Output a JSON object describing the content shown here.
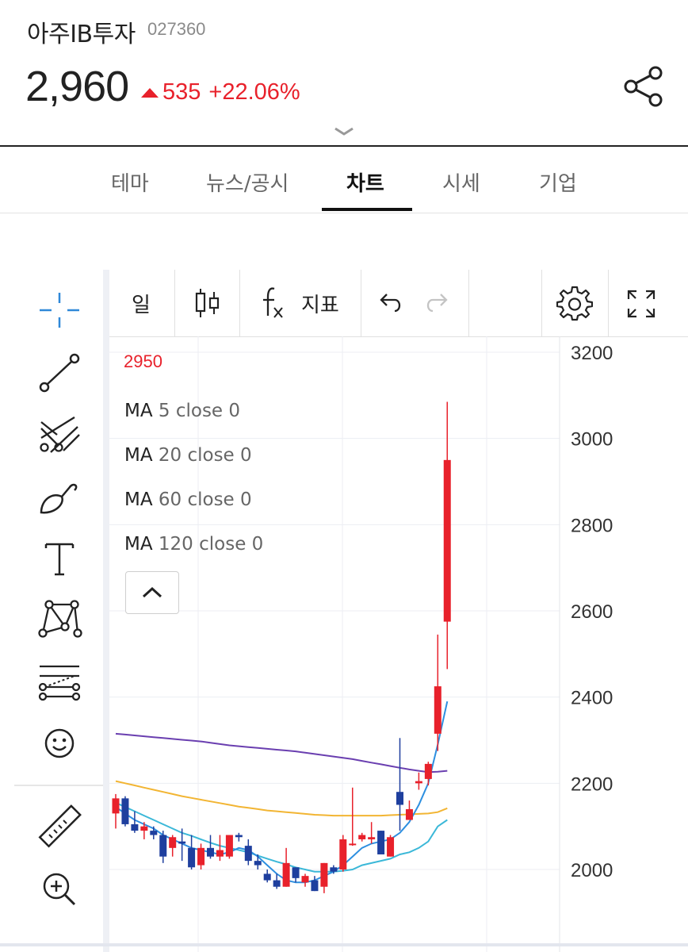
{
  "stock": {
    "name": "아주IB투자",
    "code": "027360",
    "price": "2,960",
    "change": "535",
    "change_pct": "+22.06%",
    "up_color": "#e8212b",
    "down_color": "#1e3f9e"
  },
  "icons": {
    "share": "share-icon",
    "expand": "chevron-down-icon"
  },
  "tabs": [
    {
      "label": "테마",
      "active": false
    },
    {
      "label": "뉴스/공시",
      "active": false
    },
    {
      "label": "차트",
      "active": true
    },
    {
      "label": "시세",
      "active": false
    },
    {
      "label": "기업",
      "active": false
    }
  ],
  "toolbar": {
    "period": "일",
    "candle_icon": "candlestick-icon",
    "indicator_icon": "function-icon",
    "indicator_label": "지표",
    "undo_icon": "undo-icon",
    "redo_icon": "redo-icon",
    "settings_icon": "gear-icon",
    "fullscreen_icon": "fullscreen-icon"
  },
  "drawing_tools": [
    "crosshair-icon",
    "trend-line-icon",
    "pitchfork-icon",
    "brush-icon",
    "text-icon",
    "pattern-icon",
    "fibonacci-icon",
    "emoji-icon",
    "ruler-icon",
    "zoom-in-icon"
  ],
  "legend": {
    "price": "2950",
    "ma": [
      {
        "name": "MA",
        "args": "5 close 0"
      },
      {
        "name": "MA",
        "args": "20 close 0"
      },
      {
        "name": "MA",
        "args": "60 close 0"
      },
      {
        "name": "MA",
        "args": "120 close 0"
      }
    ]
  },
  "chart_data": {
    "type": "candlestick",
    "y_ticks": [
      "3200",
      "3000",
      "2800",
      "2600",
      "2400",
      "2200",
      "2000"
    ],
    "ylim": [
      1820,
      3210
    ],
    "grid": true,
    "candles": [
      {
        "o": 2130,
        "h": 2175,
        "l": 2095,
        "c": 2165
      },
      {
        "o": 2165,
        "h": 2170,
        "l": 2100,
        "c": 2105
      },
      {
        "o": 2105,
        "h": 2135,
        "l": 2085,
        "c": 2090
      },
      {
        "o": 2090,
        "h": 2110,
        "l": 2070,
        "c": 2100
      },
      {
        "o": 2090,
        "h": 2100,
        "l": 2070,
        "c": 2080
      },
      {
        "o": 2080,
        "h": 2090,
        "l": 2015,
        "c": 2030
      },
      {
        "o": 2050,
        "h": 2080,
        "l": 2030,
        "c": 2075
      },
      {
        "o": 2065,
        "h": 2095,
        "l": 2020,
        "c": 2060
      },
      {
        "o": 2050,
        "h": 2080,
        "l": 2000,
        "c": 2005
      },
      {
        "o": 2010,
        "h": 2060,
        "l": 2000,
        "c": 2050
      },
      {
        "o": 2050,
        "h": 2080,
        "l": 2025,
        "c": 2030
      },
      {
        "o": 2030,
        "h": 2080,
        "l": 2020,
        "c": 2045
      },
      {
        "o": 2030,
        "h": 2060,
        "l": 2025,
        "c": 2080
      },
      {
        "o": 2080,
        "h": 2085,
        "l": 2065,
        "c": 2075
      },
      {
        "o": 2055,
        "h": 2070,
        "l": 2010,
        "c": 2020
      },
      {
        "o": 2020,
        "h": 2035,
        "l": 2000,
        "c": 2010
      },
      {
        "o": 1990,
        "h": 2000,
        "l": 1970,
        "c": 1975
      },
      {
        "o": 1975,
        "h": 1990,
        "l": 1955,
        "c": 1960
      },
      {
        "o": 1960,
        "h": 2050,
        "l": 1960,
        "c": 2015
      },
      {
        "o": 2005,
        "h": 2005,
        "l": 1970,
        "c": 1980
      },
      {
        "o": 1970,
        "h": 1990,
        "l": 1960,
        "c": 1985
      },
      {
        "o": 1975,
        "h": 1985,
        "l": 1950,
        "c": 1950
      },
      {
        "o": 1960,
        "h": 2015,
        "l": 1945,
        "c": 2015
      },
      {
        "o": 2005,
        "h": 2010,
        "l": 1990,
        "c": 1995
      },
      {
        "o": 2000,
        "h": 2080,
        "l": 1995,
        "c": 2070
      },
      {
        "o": 2060,
        "h": 2190,
        "l": 2055,
        "c": 2060
      },
      {
        "o": 2070,
        "h": 2085,
        "l": 2065,
        "c": 2080
      },
      {
        "o": 2070,
        "h": 2110,
        "l": 2060,
        "c": 2075
      },
      {
        "o": 2090,
        "h": 2090,
        "l": 2040,
        "c": 2035
      },
      {
        "o": 2030,
        "h": 2080,
        "l": 2030,
        "c": 2075
      },
      {
        "o": 2180,
        "h": 2305,
        "l": 2090,
        "c": 2150
      },
      {
        "o": 2115,
        "h": 2160,
        "l": 2115,
        "c": 2140
      },
      {
        "o": 2200,
        "h": 2225,
        "l": 2185,
        "c": 2205
      },
      {
        "o": 2210,
        "h": 2250,
        "l": 2195,
        "c": 2245
      },
      {
        "o": 2315,
        "h": 2545,
        "l": 2275,
        "c": 2425
      },
      {
        "o": 2575,
        "h": 3085,
        "l": 2465,
        "c": 2950
      }
    ],
    "ma5": [
      2145,
      2130,
      2115,
      2105,
      2095,
      2080,
      2070,
      2060,
      2050,
      2045,
      2040,
      2035,
      2040,
      2050,
      2045,
      2030,
      2010,
      1990,
      1975,
      1970,
      1970,
      1975,
      1985,
      1995,
      2010,
      2030,
      2050,
      2060,
      2065,
      2070,
      2085,
      2110,
      2150,
      2200,
      2290,
      2390
    ],
    "ma20": [
      2155,
      2145,
      2135,
      2125,
      2115,
      2105,
      2095,
      2085,
      2078,
      2070,
      2062,
      2055,
      2050,
      2045,
      2040,
      2032,
      2025,
      2018,
      2012,
      2005,
      2000,
      1995,
      1995,
      1995,
      1997,
      2000,
      2010,
      2015,
      2020,
      2025,
      2035,
      2040,
      2050,
      2065,
      2100,
      2115
    ],
    "ma60": [
      2205,
      2200,
      2195,
      2190,
      2185,
      2180,
      2175,
      2170,
      2166,
      2162,
      2158,
      2154,
      2150,
      2146,
      2143,
      2140,
      2137,
      2135,
      2133,
      2131,
      2129,
      2127,
      2126,
      2125,
      2125,
      2125,
      2125,
      2125,
      2125,
      2126,
      2127,
      2128,
      2129,
      2130,
      2133,
      2142
    ],
    "ma120": [
      2315,
      2313,
      2311,
      2309,
      2307,
      2305,
      2303,
      2301,
      2299,
      2297,
      2294,
      2291,
      2288,
      2286,
      2284,
      2282,
      2280,
      2278,
      2276,
      2274,
      2271,
      2268,
      2265,
      2262,
      2259,
      2256,
      2252,
      2248,
      2244,
      2240,
      2236,
      2232,
      2229,
      2226,
      2227,
      2229
    ]
  }
}
